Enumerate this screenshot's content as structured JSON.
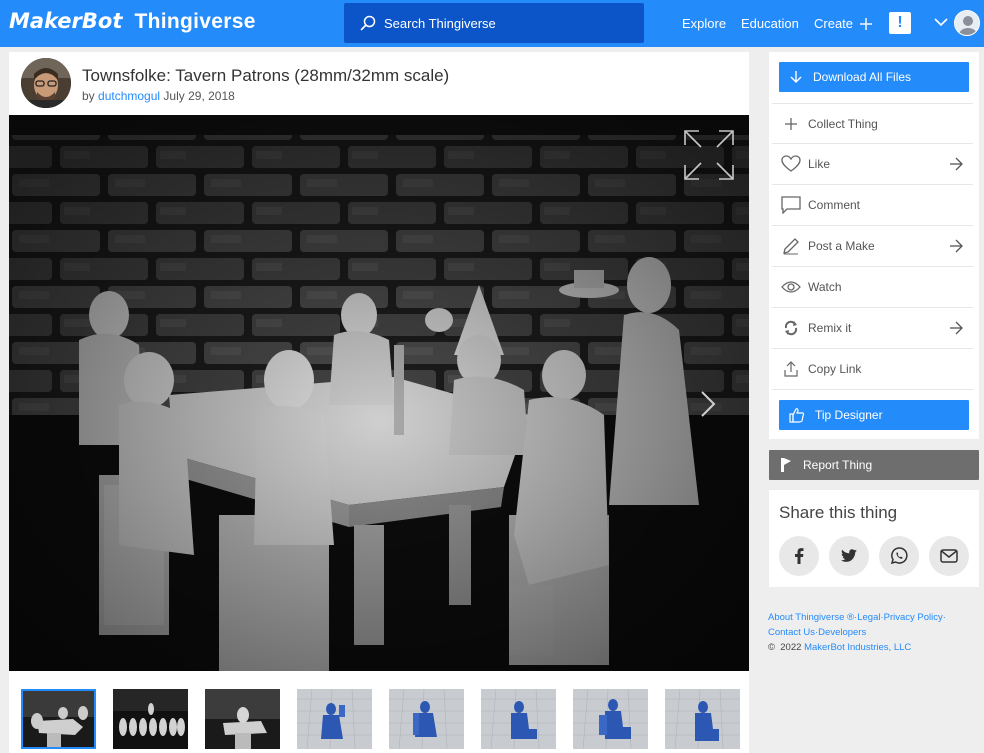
{
  "header": {
    "logo_makerbot": "MakerBot",
    "logo_thingiverse": "Thingiverse",
    "search_placeholder": "Search Thingiverse",
    "nav": {
      "explore": "Explore",
      "education": "Education",
      "create": "Create"
    },
    "alert_symbol": "!",
    "icons": [
      "search-icon",
      "plus-icon",
      "alert-icon",
      "chevron-down-icon",
      "user-avatar"
    ]
  },
  "thing": {
    "title": "Townsfolke: Tavern Patrons (28mm/32mm scale)",
    "by_label": "by",
    "author": "dutchmogul",
    "date": "July 29, 2018"
  },
  "gallery": {
    "thumbnail_count": 8,
    "active_index": 0,
    "thumb_types": [
      "photo",
      "photo",
      "photo",
      "render",
      "render",
      "render",
      "render",
      "render"
    ]
  },
  "sidebar": {
    "download_label": "Download All Files",
    "actions": [
      {
        "label": "Collect Thing",
        "icon": "plus-icon",
        "arrow": false
      },
      {
        "label": "Like",
        "icon": "heart-icon",
        "arrow": true
      },
      {
        "label": "Comment",
        "icon": "comment-icon",
        "arrow": false
      },
      {
        "label": "Post a Make",
        "icon": "pencil-icon",
        "arrow": true
      },
      {
        "label": "Watch",
        "icon": "eye-icon",
        "arrow": false
      },
      {
        "label": "Remix it",
        "icon": "remix-icon",
        "arrow": true
      },
      {
        "label": "Copy Link",
        "icon": "share-upload-icon",
        "arrow": false
      }
    ],
    "tip_label": "Tip Designer",
    "report_label": "Report Thing"
  },
  "share": {
    "title": "Share this thing",
    "networks": [
      "facebook-icon",
      "twitter-icon",
      "whatsapp-icon",
      "email-icon"
    ]
  },
  "footer": {
    "about": "About Thingiverse",
    "reg": "®",
    "legal": "Legal",
    "privacy": "Privacy Policy",
    "contact": "Contact Us",
    "developers": "Developers",
    "copyright": "©  2022 ",
    "company": "MakerBot Industries, LLC"
  },
  "colors": {
    "brand_blue": "#248bfb",
    "search_bg": "#0c55c8",
    "report_gray": "#6e6e6e",
    "page_bg": "#eeeeee"
  }
}
